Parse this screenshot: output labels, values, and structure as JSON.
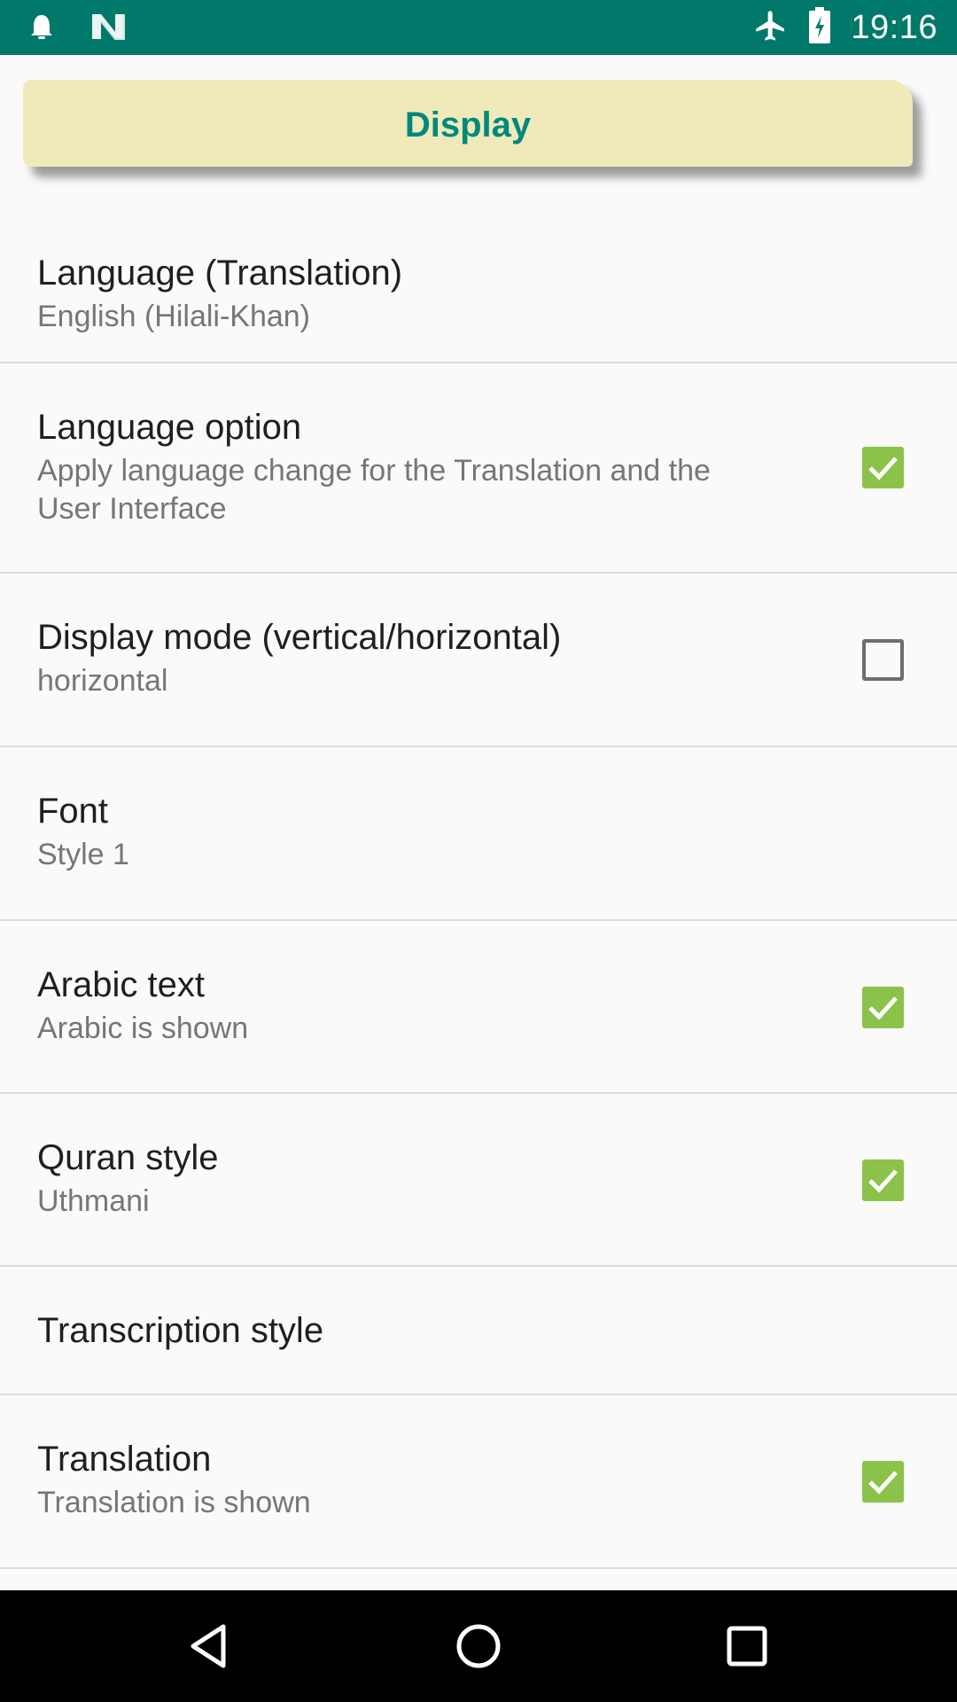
{
  "status_bar": {
    "time": "19:16",
    "left_icons": [
      "notification-bell-icon",
      "n-logo-icon"
    ],
    "right_icons": [
      "airplane-mode-icon",
      "battery-charging-icon"
    ],
    "background_color": "#00796b"
  },
  "category": {
    "title": "Display",
    "background_color": "#f0eabb",
    "title_color": "#00897b"
  },
  "preferences": [
    {
      "id": "language-translation",
      "title": "Language (Translation)",
      "summary": "English (Hilali-Khan)",
      "checkbox": null
    },
    {
      "id": "language-option",
      "title": "Language option",
      "summary": "Apply language change for the Translation and the User Interface",
      "checkbox": true
    },
    {
      "id": "display-mode",
      "title": "Display mode (vertical/horizontal)",
      "summary": "horizontal",
      "checkbox": false
    },
    {
      "id": "font",
      "title": "Font",
      "summary": "Style 1",
      "checkbox": null
    },
    {
      "id": "arabic-text",
      "title": "Arabic text",
      "summary": "Arabic is shown",
      "checkbox": true
    },
    {
      "id": "quran-style",
      "title": "Quran style",
      "summary": "Uthmani",
      "checkbox": true
    },
    {
      "id": "transcription-style",
      "title": "Transcription style",
      "summary": "",
      "checkbox": null
    },
    {
      "id": "translation",
      "title": "Translation",
      "summary": "Translation is shown",
      "checkbox": true
    }
  ],
  "checkbox_color": "#8bc34a",
  "nav_bar": {
    "buttons": [
      "back-icon",
      "home-icon",
      "recents-icon"
    ]
  }
}
